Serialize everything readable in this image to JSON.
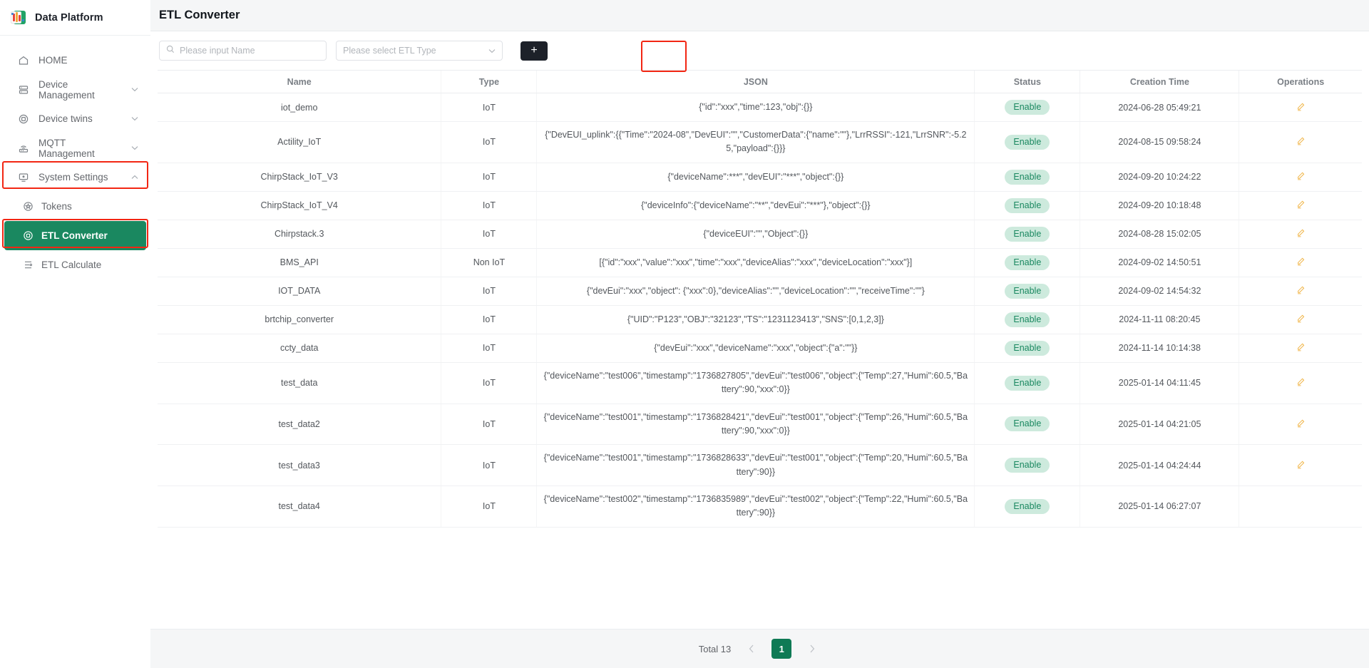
{
  "sidebar": {
    "brand": {
      "title": "Data Platform",
      "logo_icon": "bar-chart-logo-icon"
    },
    "items": [
      {
        "label": "HOME",
        "icon": "home-icon",
        "expandable": false
      },
      {
        "label": "Device Management",
        "icon": "server-icon",
        "expandable": true
      },
      {
        "label": "Device twins",
        "icon": "twins-icon",
        "expandable": true
      },
      {
        "label": "MQTT Management",
        "icon": "router-icon",
        "expandable": true
      },
      {
        "label": "System Settings",
        "icon": "monitor-icon",
        "expandable": true,
        "expanded": true,
        "highlighted": true
      }
    ],
    "sub_items": [
      {
        "label": "Tokens",
        "icon": "token-star-icon",
        "active": false
      },
      {
        "label": "ETL Converter",
        "icon": "converter-icon",
        "active": true,
        "highlighted": true
      },
      {
        "label": "ETL Calculate",
        "icon": "calculate-icon",
        "active": false
      }
    ]
  },
  "header": {
    "title": "ETL Converter"
  },
  "toolbar": {
    "search_placeholder": "Please input Name",
    "search_value": "",
    "search_icon": "search-icon",
    "select_placeholder": "Please select ETL Type",
    "select_chevron_icon": "chevron-down-icon",
    "add_label": "+",
    "add_highlighted": true
  },
  "table": {
    "columns": [
      "Name",
      "Type",
      "JSON",
      "Status",
      "Creation Time",
      "Operations"
    ],
    "rows": [
      {
        "name": "iot_demo",
        "type": "IoT",
        "json": "{\"id\":\"xxx\",\"time\":123,\"obj\":{}}",
        "status": "Enable",
        "created": "2024-06-28 05:49:21",
        "ops_icon": "edit-pencil-icon"
      },
      {
        "name": "Actility_IoT",
        "type": "IoT",
        "json": "{\"DevEUI_uplink\":{{\"Time\":\"2024-08\",\"DevEUI\":\"\",\"CustomerData\":{\"name\":\"\"},\"LrrRSSI\":-121,\"LrrSNR\":-5.25,\"payload\":{}}}",
        "status": "Enable",
        "created": "2024-08-15 09:58:24",
        "ops_icon": "edit-pencil-icon"
      },
      {
        "name": "ChirpStack_IoT_V3",
        "type": "IoT",
        "json": "{\"deviceName\":***\",\"devEUI\":\"***\",\"object\":{}}",
        "status": "Enable",
        "created": "2024-09-20 10:24:22",
        "ops_icon": "edit-pencil-icon"
      },
      {
        "name": "ChirpStack_IoT_V4",
        "type": "IoT",
        "json": "{\"deviceInfo\":{\"deviceName\":\"**\",\"devEui\":\"***\"},\"object\":{}}",
        "status": "Enable",
        "created": "2024-09-20 10:18:48",
        "ops_icon": "edit-pencil-icon"
      },
      {
        "name": "Chirpstack.3",
        "type": "IoT",
        "json": "{\"deviceEUI\":\"\",\"Object\":{}}",
        "status": "Enable",
        "created": "2024-08-28 15:02:05",
        "ops_icon": "edit-pencil-icon"
      },
      {
        "name": "BMS_API",
        "type": "Non IoT",
        "json": "[{\"id\":\"xxx\",\"value\":\"xxx\",\"time\":\"xxx\",\"deviceAlias\":\"xxx\",\"deviceLocation\":\"xxx\"}]",
        "status": "Enable",
        "created": "2024-09-02 14:50:51",
        "ops_icon": "edit-pencil-icon"
      },
      {
        "name": "IOT_DATA",
        "type": "IoT",
        "json": "{\"devEui\":\"xxx\",\"object\": {\"xxx\":0},\"deviceAlias\":\"\",\"deviceLocation\":\"\",\"receiveTime\":\"\"}",
        "status": "Enable",
        "created": "2024-09-02 14:54:32",
        "ops_icon": "edit-pencil-icon"
      },
      {
        "name": "brtchip_converter",
        "type": "IoT",
        "json": "{\"UID\":\"P123\",\"OBJ\":\"32123\",\"TS\":\"1231123413\",\"SNS\":[0,1,2,3]}",
        "status": "Enable",
        "created": "2024-11-11 08:20:45",
        "ops_icon": "edit-pencil-icon"
      },
      {
        "name": "ccty_data",
        "type": "IoT",
        "json": "{\"devEui\":\"xxx\",\"deviceName\":\"xxx\",\"object\":{\"a\":\"\"}}",
        "status": "Enable",
        "created": "2024-11-14 10:14:38",
        "ops_icon": "edit-pencil-icon"
      },
      {
        "name": "test_data",
        "type": "IoT",
        "json": "{\"deviceName\":\"test006\",\"timestamp\":\"1736827805\",\"devEui\":\"test006\",\"object\":{\"Temp\":27,\"Humi\":60.5,\"Battery\":90,\"xxx\":0}}",
        "status": "Enable",
        "created": "2025-01-14 04:11:45",
        "ops_icon": "edit-pencil-icon"
      },
      {
        "name": "test_data2",
        "type": "IoT",
        "json": "{\"deviceName\":\"test001\",\"timestamp\":\"1736828421\",\"devEui\":\"test001\",\"object\":{\"Temp\":26,\"Humi\":60.5,\"Battery\":90,\"xxx\":0}}",
        "status": "Enable",
        "created": "2025-01-14 04:21:05",
        "ops_icon": "edit-pencil-icon"
      },
      {
        "name": "test_data3",
        "type": "IoT",
        "json": "{\"deviceName\":\"test001\",\"timestamp\":\"1736828633\",\"devEui\":\"test001\",\"object\":{\"Temp\":20,\"Humi\":60.5,\"Battery\":90}}",
        "status": "Enable",
        "created": "2025-01-14 04:24:44",
        "ops_icon": "edit-pencil-icon"
      },
      {
        "name": "test_data4",
        "type": "IoT",
        "json": "{\"deviceName\":\"test002\",\"timestamp\":\"1736835989\",\"devEui\":\"test002\",\"object\":{\"Temp\":22,\"Humi\":60.5,\"Battery\":90}}",
        "status": "Enable",
        "created": "2025-01-14 06:27:07",
        "ops_icon": ""
      }
    ]
  },
  "pagination": {
    "total_label": "Total 13",
    "prev_icon": "chevron-left-icon",
    "next_icon": "chevron-right-icon",
    "current_page": "1"
  },
  "colors": {
    "accent_green": "#1a8860",
    "pager_green": "#0f7a55",
    "json_teal": "#2fa0ae",
    "badge_bg": "#cdeadd",
    "highlight_red": "#f22613",
    "edit_amber": "#f0b445",
    "add_btn_dark": "#1d2129"
  }
}
